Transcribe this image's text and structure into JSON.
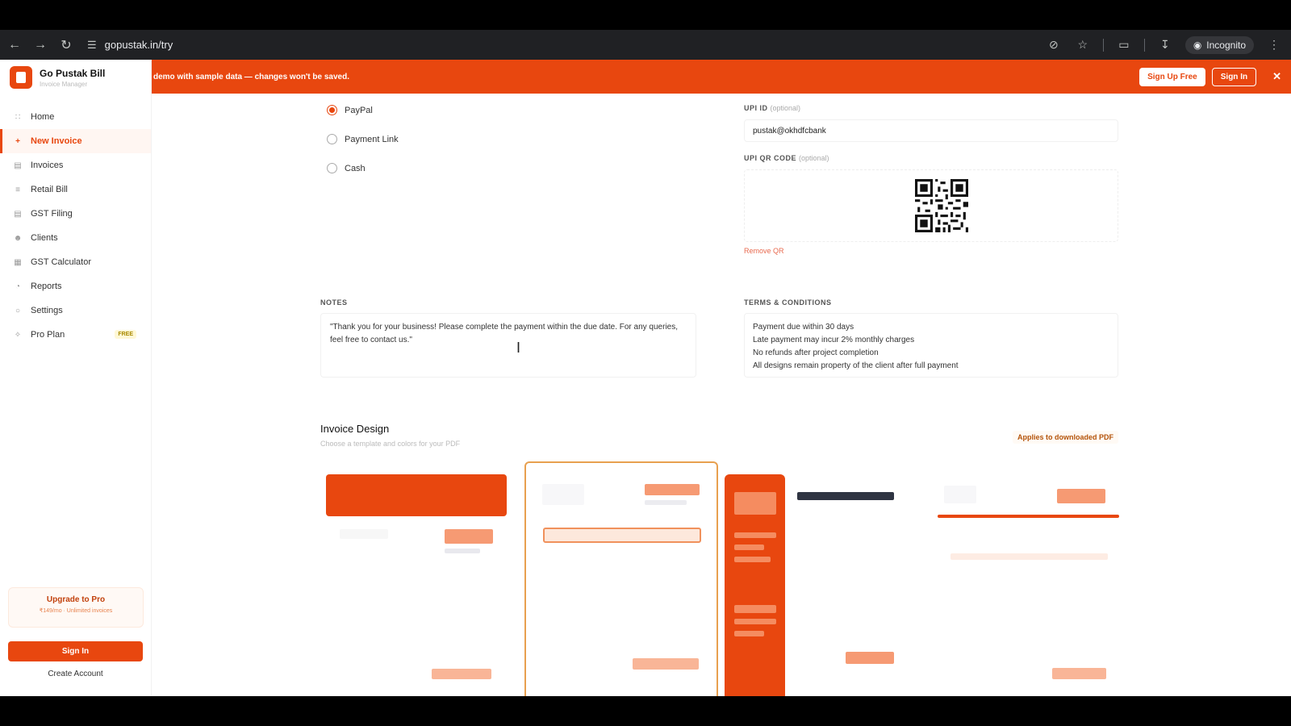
{
  "browser": {
    "url": "gopustak.in/try",
    "incognito_label": "Incognito"
  },
  "sidebar": {
    "brand_name": "Go Pustak Bill",
    "brand_sub": "Invoice Manager",
    "items": [
      {
        "label": "Home",
        "icon": "grid-icon"
      },
      {
        "label": "New Invoice",
        "icon": "plus-icon"
      },
      {
        "label": "Invoices",
        "icon": "document-icon"
      },
      {
        "label": "Retail Bill",
        "icon": "cart-icon"
      },
      {
        "label": "GST Filing",
        "icon": "file-icon"
      },
      {
        "label": "Clients",
        "icon": "user-icon"
      },
      {
        "label": "GST Calculator",
        "icon": "calculator-icon"
      },
      {
        "label": "Reports",
        "icon": "pie-icon"
      },
      {
        "label": "Settings",
        "icon": "gear-icon"
      },
      {
        "label": "Pro Plan",
        "icon": "sparkle-icon"
      }
    ],
    "pro_badge": "FREE",
    "upgrade_title": "Upgrade to Pro",
    "upgrade_sub": "₹149/mo · Unlimited invoices",
    "signin_label": "Sign In",
    "create_account_label": "Create Account"
  },
  "banner": {
    "text": "demo with sample data — changes won't be saved.",
    "signup_label": "Sign Up Free",
    "signin_label": "Sign In",
    "accent": "#e8470f"
  },
  "payment": {
    "methods": [
      {
        "label": "PayPal",
        "checked": true
      },
      {
        "label": "Payment Link",
        "checked": false
      },
      {
        "label": "Cash",
        "checked": false
      }
    ],
    "upi_label": "UPI ID",
    "upi_optional": "(optional)",
    "upi_value": "pustak@okhdfcbank",
    "qr_label": "UPI QR CODE",
    "qr_optional": "(optional)",
    "remove_qr": "Remove QR"
  },
  "notes": {
    "label": "NOTES",
    "text": "\"Thank you for your business! Please complete the payment within the due date. For any queries, feel free to contact us.\""
  },
  "terms": {
    "label": "TERMS & CONDITIONS",
    "lines": [
      "Payment due within 30 days",
      "Late payment may incur 2% monthly charges",
      "No refunds after project completion",
      "All designs remain property of the client after full payment"
    ]
  },
  "design": {
    "title": "Invoice Design",
    "subtitle": "Choose a template and colors for your PDF",
    "applies_note": "Applies to downloaded PDF"
  }
}
